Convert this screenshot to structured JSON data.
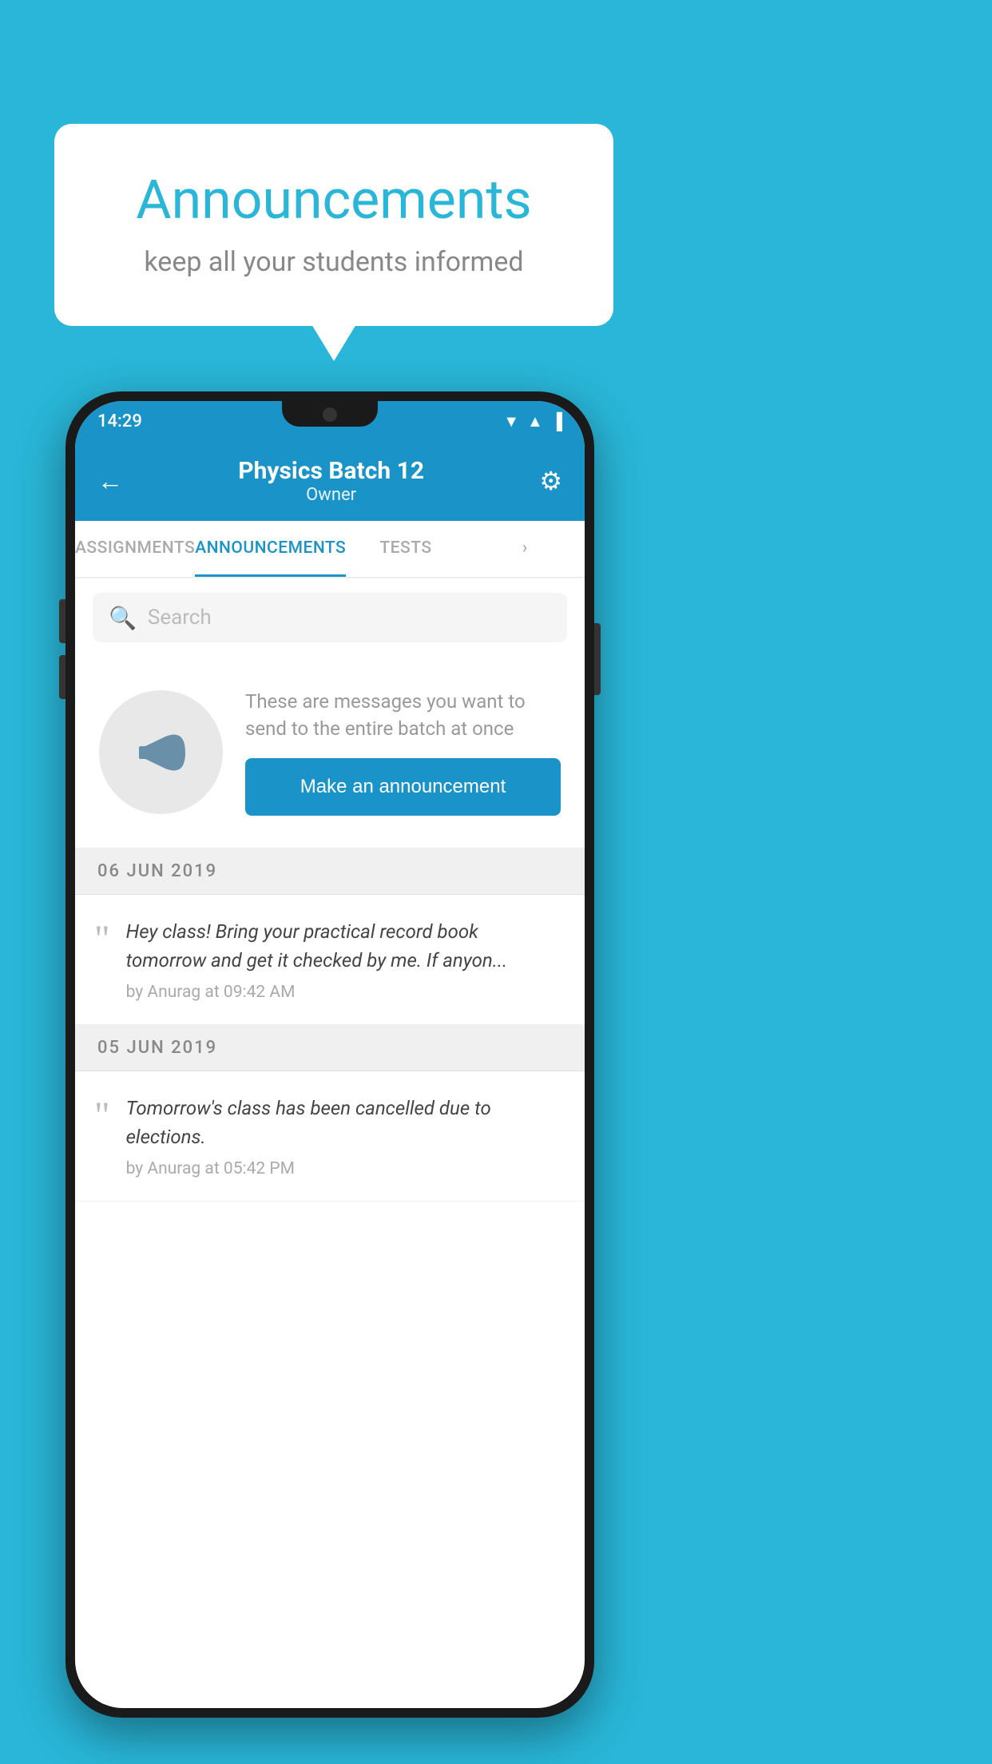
{
  "background_color": "#29b6d8",
  "bubble": {
    "title": "Announcements",
    "subtitle": "keep all your students informed"
  },
  "phone": {
    "status_bar": {
      "time": "14:29",
      "icons": [
        "wifi",
        "signal",
        "battery"
      ]
    },
    "header": {
      "back_label": "←",
      "title": "Physics Batch 12",
      "subtitle": "Owner",
      "gear_label": "⚙"
    },
    "tabs": [
      {
        "label": "ASSIGNMENTS",
        "active": false
      },
      {
        "label": "ANNOUNCEMENTS",
        "active": true
      },
      {
        "label": "TESTS",
        "active": false
      },
      {
        "label": "",
        "active": false
      }
    ],
    "search": {
      "placeholder": "Search"
    },
    "cta": {
      "description": "These are messages you want to send to the entire batch at once",
      "button_label": "Make an announcement"
    },
    "announcements": [
      {
        "date": "06  JUN  2019",
        "message": "Hey class! Bring your practical record book tomorrow and get it checked by me. If anyon...",
        "meta": "by Anurag at 09:42 AM"
      },
      {
        "date": "05  JUN  2019",
        "message": "Tomorrow's class has been cancelled due to elections.",
        "meta": "by Anurag at 05:42 PM"
      }
    ]
  }
}
